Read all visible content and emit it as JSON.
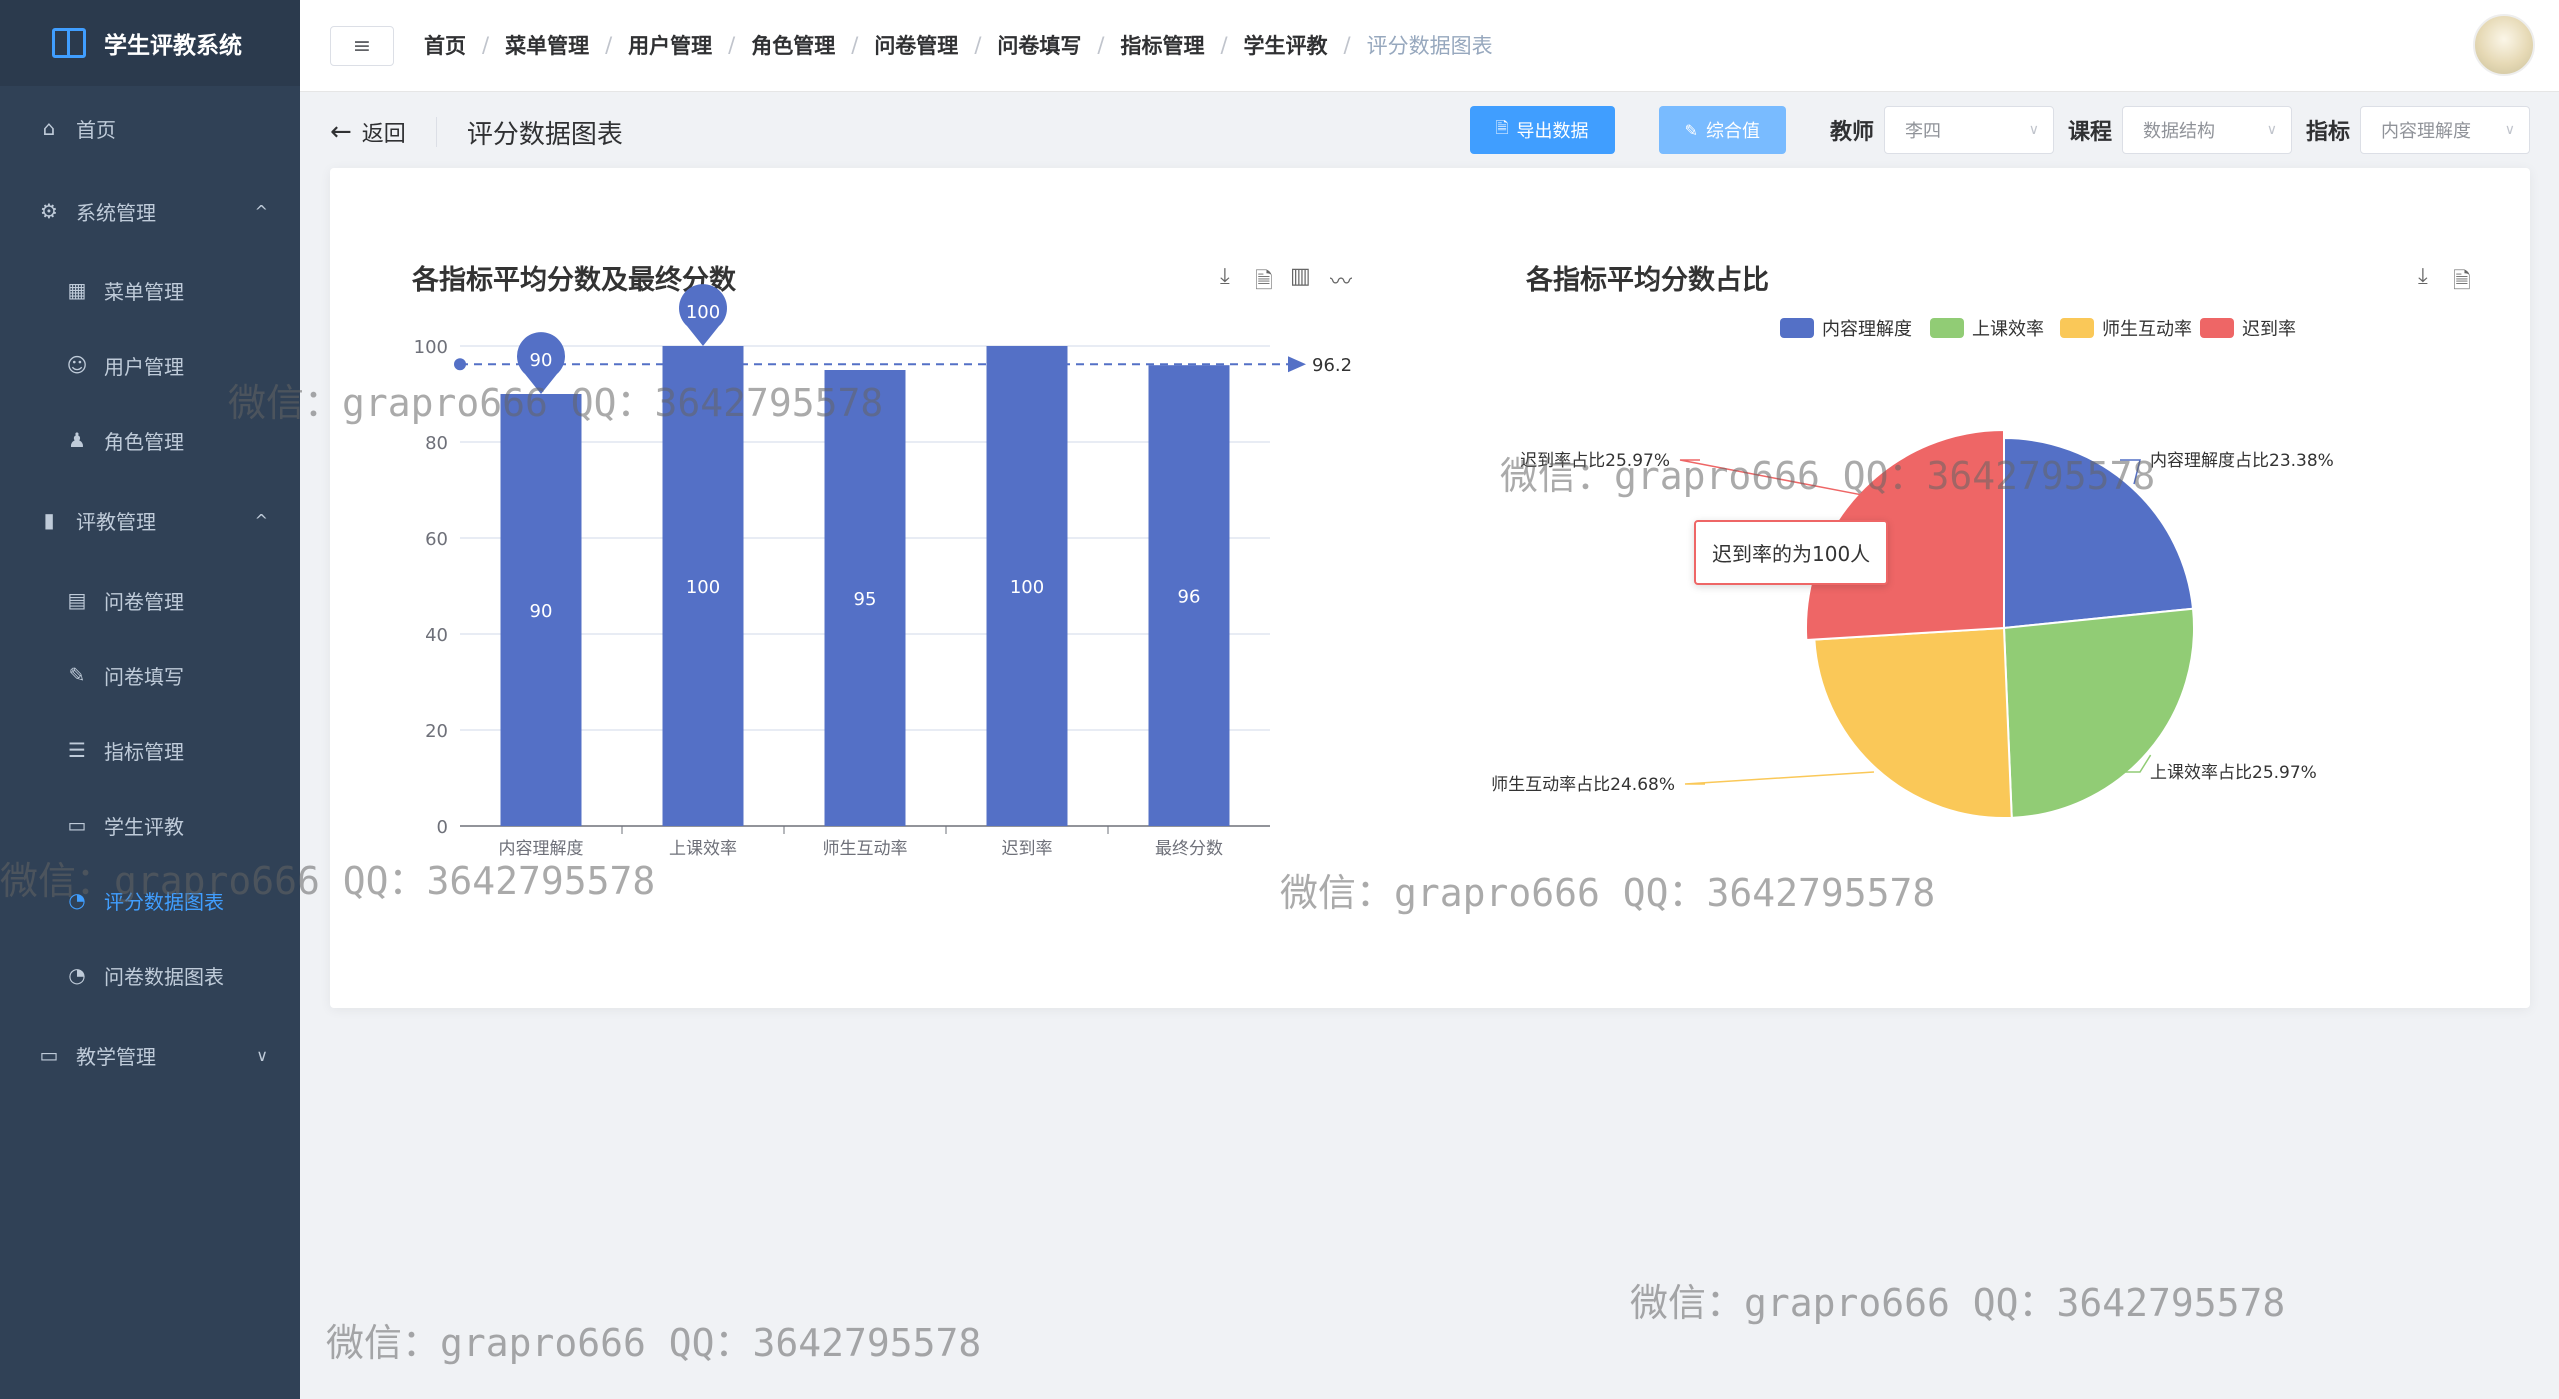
{
  "app": {
    "title": "学生评教系统"
  },
  "sidebar": {
    "items": [
      {
        "label": "首页",
        "icon": "home-icon"
      },
      {
        "label": "系统管理",
        "icon": "gear-icon"
      },
      {
        "label": "菜单管理",
        "icon": "grid-icon"
      },
      {
        "label": "用户管理",
        "icon": "user-icon"
      },
      {
        "label": "角色管理",
        "icon": "role-icon"
      },
      {
        "label": "评教管理",
        "icon": "bar-chart-icon"
      },
      {
        "label": "问卷管理",
        "icon": "document-icon"
      },
      {
        "label": "问卷填写",
        "icon": "edit-icon"
      },
      {
        "label": "指标管理",
        "icon": "sliders-icon"
      },
      {
        "label": "学生评教",
        "icon": "folder-icon"
      },
      {
        "label": "评分数据图表",
        "icon": "pie-chart-icon"
      },
      {
        "label": "问卷数据图表",
        "icon": "pie-chart-icon"
      },
      {
        "label": "教学管理",
        "icon": "folder-icon"
      }
    ]
  },
  "breadcrumb": [
    "首页",
    "菜单管理",
    "用户管理",
    "角色管理",
    "问卷管理",
    "问卷填写",
    "指标管理",
    "学生评教",
    "评分数据图表"
  ],
  "toolbar": {
    "back_label": "返回",
    "page_title": "评分数据图表",
    "export_label": "导出数据",
    "composite_label": "综合值",
    "teacher_label": "教师",
    "teacher_value": "李四",
    "course_label": "课程",
    "course_value": "数据结构",
    "indicator_label": "指标",
    "indicator_value": "内容理解度"
  },
  "watermark_text": "微信：grapro666 QQ：3642795578",
  "chart_data": [
    {
      "type": "bar",
      "title": "各指标平均分数及最终分数",
      "categories": [
        "内容理解度",
        "上课效率",
        "师生互动率",
        "迟到率",
        "最终分数"
      ],
      "values": [
        90,
        100,
        95,
        100,
        96
      ],
      "ylim": [
        0,
        100
      ],
      "yticks": [
        0,
        20,
        40,
        60,
        80,
        100
      ],
      "markpoint_labels": [
        "90",
        "100"
      ],
      "markline_value": "96.2",
      "color": "#5470c6",
      "grid": true
    },
    {
      "type": "pie",
      "title": "各指标平均分数占比",
      "legend": [
        "内容理解度",
        "上课效率",
        "师生互动率",
        "迟到率"
      ],
      "legend_position": "top",
      "values": [
        23.38,
        25.97,
        24.68,
        25.97
      ],
      "slice_labels": [
        "内容理解度占比23.38%",
        "上课效率占比25.97%",
        "师生互动率占比24.68%",
        "迟到率占比25.97%"
      ],
      "colors": [
        "#5470c6",
        "#91cc75",
        "#fac858",
        "#ee6666"
      ],
      "tooltip": "迟到率的为100人"
    }
  ],
  "colors": {
    "sidebar_bg": "#304156",
    "accent": "#409eff",
    "bar": "#5470c6"
  }
}
